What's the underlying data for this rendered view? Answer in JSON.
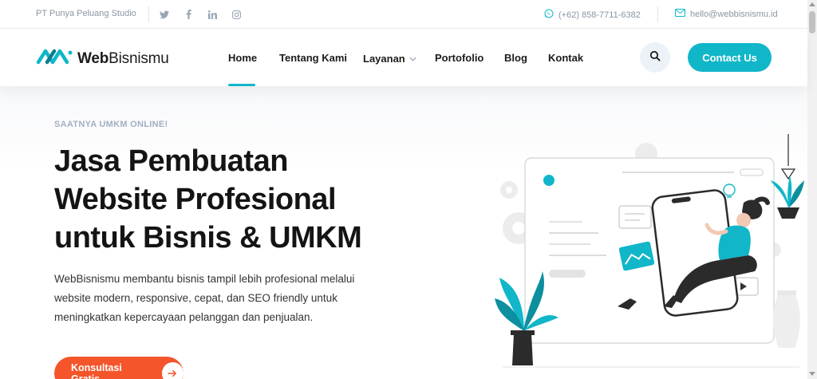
{
  "topbar": {
    "company": "PT Punya Peluang Studio",
    "social_icons": [
      "twitter-icon",
      "facebook-icon",
      "linkedin-icon",
      "instagram-icon"
    ],
    "phone": "(+62) 858-7711-6382",
    "email": "hello@webbisnismu.id"
  },
  "header": {
    "logo_text_bold": "Web",
    "logo_text_rest": "Bisnismu",
    "nav": [
      {
        "label": "Home",
        "active": true
      },
      {
        "label": "Tentang Kami"
      },
      {
        "label": "Layanan",
        "has_dropdown": true
      },
      {
        "label": "Portofolio"
      },
      {
        "label": "Blog"
      },
      {
        "label": "Kontak"
      }
    ],
    "contact_button": "Contact Us"
  },
  "hero": {
    "eyebrow": "SAATNYA UMKM ONLINE!",
    "headline_line1": "Jasa Pembuatan",
    "headline_line2": "Website Profesional",
    "headline_line3": "untuk Bisnis & UMKM",
    "description": "WebBisnismu membantu bisnis tampil lebih profesional melalui website modern, responsive, cepat, dan SEO friendly untuk meningkatkan kepercayaan pelanggan dan penjualan.",
    "cta": "Konsultasi Gratis"
  },
  "colors": {
    "accent": "#11b6c9",
    "cta": "#f4552a",
    "text": "#141414",
    "muted": "#8a96a3"
  }
}
